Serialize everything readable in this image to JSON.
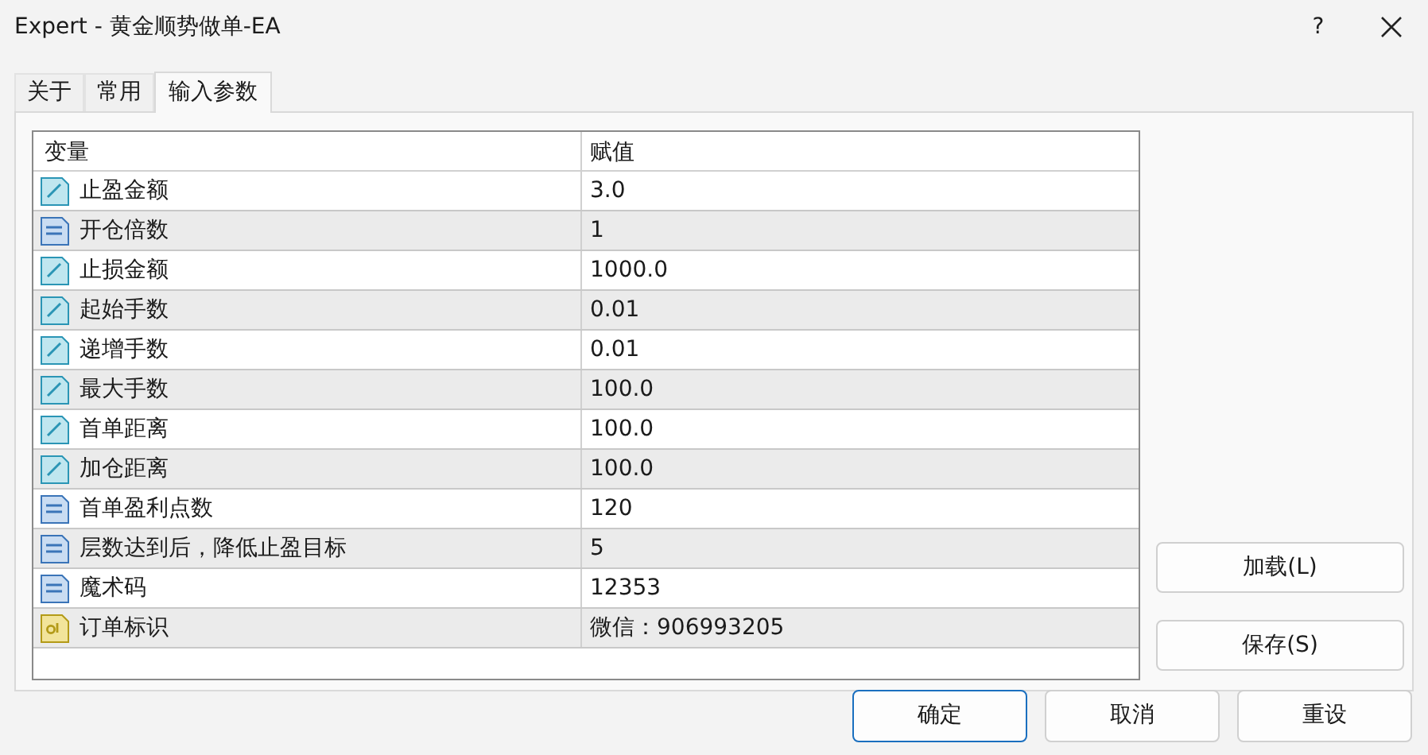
{
  "window": {
    "title": "Expert - 黄金顺势做单-EA",
    "help": "?"
  },
  "tabs": [
    {
      "label": "关于",
      "selected": false
    },
    {
      "label": "常用",
      "selected": false
    },
    {
      "label": "输入参数",
      "selected": true
    }
  ],
  "table": {
    "columns": [
      "变量",
      "赋值"
    ],
    "rows": [
      {
        "kind": "double",
        "name": "止盈金额",
        "value": "3.0"
      },
      {
        "kind": "int",
        "name": "开仓倍数",
        "value": "1"
      },
      {
        "kind": "double",
        "name": "止损金额",
        "value": "1000.0"
      },
      {
        "kind": "double",
        "name": "起始手数",
        "value": "0.01"
      },
      {
        "kind": "double",
        "name": "递增手数",
        "value": "0.01"
      },
      {
        "kind": "double",
        "name": "最大手数",
        "value": "100.0"
      },
      {
        "kind": "double",
        "name": "首单距离",
        "value": "100.0"
      },
      {
        "kind": "double",
        "name": "加仓距离",
        "value": "100.0"
      },
      {
        "kind": "int",
        "name": "首单盈利点数",
        "value": "120"
      },
      {
        "kind": "int",
        "name": "层数达到后，降低止盈目标",
        "value": "5"
      },
      {
        "kind": "int",
        "name": "魔术码",
        "value": "12353"
      },
      {
        "kind": "string",
        "name": "订单标识",
        "value": "微信：906993205"
      }
    ]
  },
  "side_buttons": [
    "加载(L)",
    "保存(S)"
  ],
  "buttons": [
    {
      "label": "确定",
      "default": true
    },
    {
      "label": "取消",
      "default": false
    },
    {
      "label": "重设",
      "default": false
    }
  ]
}
